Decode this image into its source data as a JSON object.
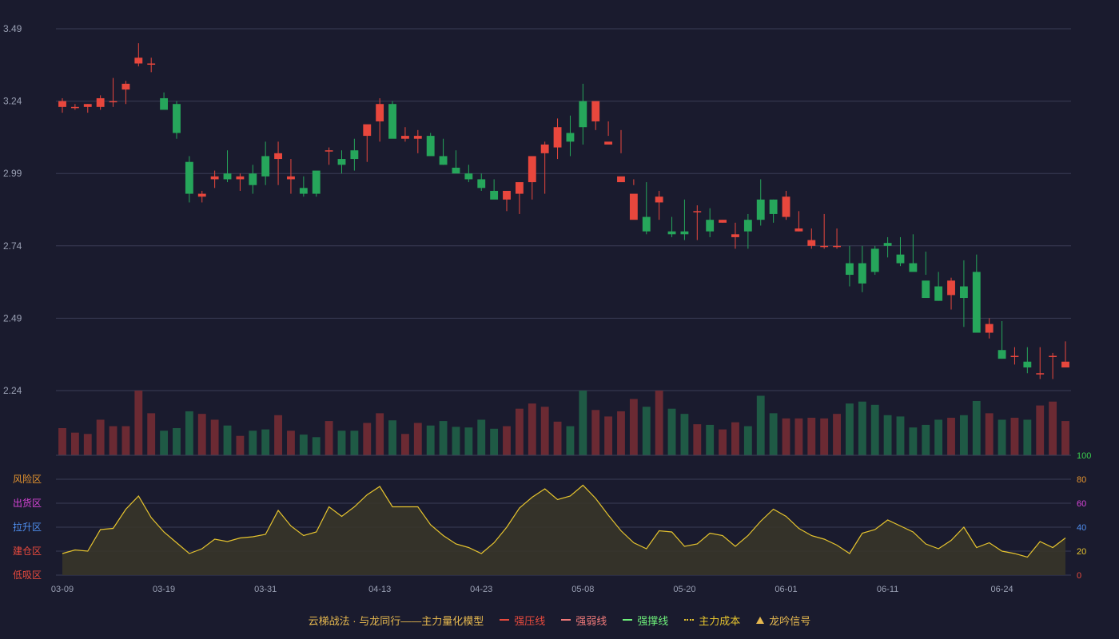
{
  "colors": {
    "background": "#1a1b2e",
    "grid": "#3a3d55",
    "axis_text": "#9aa0b4",
    "up": "#e8473d",
    "down": "#26a65b",
    "vol_up": "#6b2a33",
    "vol_down": "#1f5a45",
    "oscillator_line": "#e6c42e",
    "oscillator_fill": "#3a3628"
  },
  "chart_data": [
    {
      "type": "candlestick",
      "x": [
        "03-09",
        "03-10",
        "03-11",
        "03-12",
        "03-13",
        "03-16",
        "03-17",
        "03-18",
        "03-19",
        "03-20",
        "03-23",
        "03-24",
        "03-25",
        "03-26",
        "03-27",
        "03-30",
        "03-31",
        "04-01",
        "04-02",
        "04-03",
        "04-07",
        "04-08",
        "04-09",
        "04-10",
        "04-11",
        "04-13",
        "04-14",
        "04-15",
        "04-16",
        "04-17",
        "04-18",
        "04-21",
        "04-22",
        "04-23",
        "04-24",
        "04-25",
        "04-28",
        "04-29",
        "04-30",
        "05-06",
        "05-07",
        "05-08",
        "05-09",
        "05-12",
        "05-13",
        "05-14",
        "05-15",
        "05-16",
        "05-19",
        "05-20",
        "05-21",
        "05-22",
        "05-23",
        "05-26",
        "05-27",
        "05-28",
        "05-29",
        "06-01",
        "06-02",
        "06-03",
        "06-04",
        "06-05",
        "06-06",
        "06-09",
        "06-10",
        "06-11",
        "06-12",
        "06-13",
        "06-16",
        "06-17",
        "06-18",
        "06-19",
        "06-20",
        "06-23",
        "06-24",
        "06-25",
        "06-26",
        "06-27",
        "06-30",
        "07-01"
      ],
      "open": [
        3.22,
        3.22,
        3.22,
        3.22,
        3.24,
        3.28,
        3.37,
        3.37,
        3.25,
        3.23,
        3.03,
        2.91,
        2.97,
        2.99,
        2.97,
        2.99,
        3.05,
        3.04,
        2.97,
        2.94,
        3.0,
        3.07,
        3.04,
        3.07,
        3.12,
        3.17,
        3.23,
        3.11,
        3.11,
        3.12,
        3.05,
        3.01,
        2.99,
        2.97,
        2.93,
        2.9,
        2.92,
        2.96,
        3.06,
        3.08,
        3.13,
        3.24,
        3.17,
        3.09,
        2.96,
        2.83,
        2.84,
        2.89,
        2.79,
        2.79,
        2.86,
        2.83,
        2.82,
        2.77,
        2.83,
        2.9,
        2.9,
        2.84,
        2.79,
        2.74,
        2.74,
        2.74,
        2.68,
        2.68,
        2.73,
        2.75,
        2.71,
        2.68,
        2.62,
        2.6,
        2.57,
        2.6,
        2.65,
        2.44,
        2.38,
        2.36,
        2.34,
        2.3,
        2.36,
        2.32
      ],
      "close": [
        3.24,
        3.22,
        3.23,
        3.25,
        3.24,
        3.3,
        3.39,
        3.37,
        3.21,
        3.13,
        2.92,
        2.92,
        2.98,
        2.97,
        2.98,
        2.95,
        2.98,
        3.06,
        2.98,
        2.92,
        2.92,
        3.07,
        3.02,
        3.04,
        3.16,
        3.23,
        3.11,
        3.12,
        3.12,
        3.05,
        3.02,
        2.99,
        2.97,
        2.94,
        2.9,
        2.93,
        2.96,
        3.05,
        3.09,
        3.15,
        3.1,
        3.15,
        3.24,
        3.1,
        2.98,
        2.92,
        2.79,
        2.91,
        2.78,
        2.78,
        2.86,
        2.79,
        2.83,
        2.78,
        2.79,
        2.83,
        2.85,
        2.91,
        2.8,
        2.76,
        2.74,
        2.74,
        2.64,
        2.61,
        2.65,
        2.74,
        2.68,
        2.65,
        2.56,
        2.55,
        2.62,
        2.56,
        2.44,
        2.47,
        2.35,
        2.36,
        2.32,
        2.3,
        2.36,
        2.34
      ],
      "high": [
        3.25,
        3.23,
        3.23,
        3.26,
        3.32,
        3.31,
        3.44,
        3.39,
        3.27,
        3.24,
        3.05,
        2.93,
        3.0,
        3.07,
        2.99,
        3.02,
        3.1,
        3.1,
        3.04,
        2.98,
        2.94,
        3.08,
        3.07,
        3.11,
        3.13,
        3.25,
        3.24,
        3.15,
        3.14,
        3.13,
        3.11,
        3.07,
        3.02,
        2.99,
        2.97,
        2.91,
        2.95,
        2.99,
        3.1,
        3.18,
        3.19,
        3.3,
        3.24,
        3.17,
        3.14,
        2.97,
        2.96,
        2.93,
        2.84,
        2.9,
        2.88,
        2.87,
        2.83,
        2.82,
        2.85,
        2.97,
        2.9,
        2.93,
        2.86,
        2.8,
        2.85,
        2.8,
        2.74,
        2.74,
        2.74,
        2.77,
        2.77,
        2.78,
        2.72,
        2.65,
        2.63,
        2.69,
        2.71,
        2.49,
        2.48,
        2.39,
        2.39,
        2.39,
        2.37,
        2.41,
        2.38
      ],
      "low": [
        3.2,
        3.21,
        3.2,
        3.21,
        3.22,
        3.23,
        3.36,
        3.34,
        3.22,
        3.11,
        2.89,
        2.89,
        2.94,
        2.96,
        2.93,
        2.92,
        2.95,
        2.95,
        2.92,
        2.91,
        2.91,
        3.02,
        2.99,
        3.0,
        3.03,
        3.1,
        3.14,
        3.1,
        3.06,
        3.07,
        3.02,
        3.0,
        2.96,
        2.93,
        2.91,
        2.86,
        2.85,
        2.9,
        2.92,
        3.04,
        3.05,
        3.09,
        3.14,
        3.12,
        3.06,
        2.95,
        2.78,
        2.83,
        2.77,
        2.76,
        2.76,
        2.77,
        2.82,
        2.73,
        2.73,
        2.81,
        2.82,
        2.83,
        2.79,
        2.73,
        2.73,
        2.73,
        2.6,
        2.58,
        2.64,
        2.7,
        2.67,
        2.66,
        2.64,
        2.55,
        2.52,
        2.46,
        2.56,
        2.42,
        2.35,
        2.33,
        2.3,
        2.28,
        2.28,
        2.34,
        2.31
      ]
    },
    {
      "type": "bar",
      "series_role": "volume",
      "values": [
        42,
        35,
        33,
        55,
        45,
        45,
        100,
        65,
        38,
        42,
        68,
        64,
        55,
        46,
        30,
        38,
        40,
        62,
        38,
        32,
        28,
        53,
        38,
        38,
        50,
        65,
        54,
        33,
        50,
        46,
        53,
        44,
        43,
        55,
        41,
        45,
        72,
        80,
        75,
        52,
        45,
        115,
        70,
        60,
        68,
        87,
        75,
        105,
        72,
        64,
        48,
        47,
        40,
        51,
        45,
        92,
        65,
        57,
        57,
        58,
        57,
        64,
        80,
        83,
        78,
        62,
        60,
        43,
        47,
        55,
        58,
        62,
        84,
        65,
        55,
        58,
        55,
        77,
        83,
        53
      ],
      "ylim": [
        0,
        100
      ]
    },
    {
      "type": "area",
      "x_ticks": [
        "03-09",
        "03-19",
        "03-31",
        "04-13",
        "04-23",
        "05-08",
        "05-20",
        "06-01",
        "06-11",
        "06-24"
      ],
      "values": [
        18,
        21,
        20,
        38,
        39,
        55,
        66,
        48,
        36,
        27,
        18,
        22,
        30,
        28,
        31,
        32,
        34,
        54,
        41,
        33,
        36,
        57,
        49,
        57,
        67,
        74,
        57,
        57,
        57,
        42,
        33,
        26,
        23,
        18,
        27,
        40,
        56,
        65,
        72,
        63,
        66,
        75,
        64,
        50,
        37,
        27,
        22,
        37,
        36,
        24,
        26,
        35,
        33,
        24,
        33,
        45,
        55,
        49,
        39,
        33,
        30,
        25,
        18,
        35,
        38,
        46,
        41,
        36,
        26,
        22,
        29,
        40,
        23,
        27,
        20,
        18,
        15,
        28,
        23,
        31
      ],
      "ylim": [
        0,
        100
      ],
      "y_ticks_right": [
        0,
        20,
        40,
        60,
        80,
        100
      ],
      "zones": [
        "风险区",
        "出货区",
        "拉升区",
        "建仓区",
        "低吸区"
      ]
    }
  ],
  "price_axis": {
    "ticks": [
      3.49,
      3.24,
      2.99,
      2.74,
      2.49,
      2.24
    ],
    "labels": [
      "3.49",
      "3.24",
      "2.99",
      "2.74",
      "2.49",
      "2.24"
    ],
    "ylim": [
      2.24,
      3.49
    ]
  },
  "x_axis": {
    "labels": [
      "03-09",
      "03-19",
      "03-31",
      "04-13",
      "04-23",
      "05-08",
      "05-20",
      "06-01",
      "06-11",
      "06-24"
    ]
  },
  "oscillator_axis": {
    "labels": [
      "100",
      "80",
      "60",
      "40",
      "20",
      "0"
    ],
    "label_colors": [
      "#3ad14e",
      "#e6952e",
      "#d845d8",
      "#4f8ff0",
      "#e6c42e",
      "#e84a3d"
    ]
  },
  "zones": {
    "labels": [
      "风险区",
      "出货区",
      "拉升区",
      "建仓区",
      "低吸区"
    ],
    "colors": [
      "#e6952e",
      "#d845d8",
      "#4f8ff0",
      "#e84a3d",
      "#e84a3d"
    ]
  },
  "legend": {
    "title": "云梯战法 · 与龙同行——主力量化模型",
    "title_color": "#e6b84f",
    "items": [
      {
        "label": "强压线",
        "color": "#e84a3d",
        "icon": "solid-line-icon"
      },
      {
        "label": "强弱线",
        "color": "#f07a7a",
        "icon": "dashed-line-icon"
      },
      {
        "label": "强撑线",
        "color": "#6ef07a",
        "icon": "solid-line-icon"
      },
      {
        "label": "主力成本",
        "color": "#e6c42e",
        "icon": "dotted-line-icon"
      },
      {
        "label": "龙吟信号",
        "color": "#e6b84f",
        "icon": "triangle-icon"
      }
    ]
  }
}
